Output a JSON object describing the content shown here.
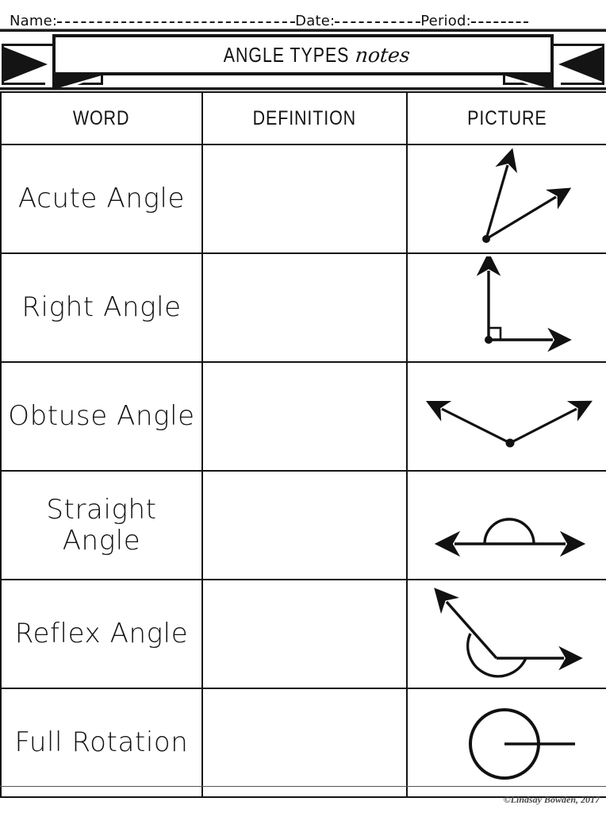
{
  "header": {
    "name_label": "Name:",
    "date_label": "Date:",
    "period_label": "Period:",
    "name_value": "",
    "date_value": "",
    "period_value": ""
  },
  "banner": {
    "title_caps": "ANGLE TYPES",
    "title_script": "notes"
  },
  "table": {
    "columns": [
      "WORD",
      "DEFINITION",
      "PICTURE"
    ],
    "rows": [
      {
        "word": "Acute Angle",
        "definition": "",
        "picture": "acute-angle-diagram"
      },
      {
        "word": "Right Angle",
        "definition": "",
        "picture": "right-angle-diagram"
      },
      {
        "word": "Obtuse Angle",
        "definition": "",
        "picture": "obtuse-angle-diagram"
      },
      {
        "word": "Straight Angle",
        "definition": "",
        "picture": "straight-angle-diagram"
      },
      {
        "word": "Reflex Angle",
        "definition": "",
        "picture": "reflex-angle-diagram"
      },
      {
        "word": "Full Rotation",
        "definition": "",
        "picture": "full-rotation-diagram"
      }
    ]
  },
  "footer": {
    "copyright": "©Lindsay Bowden, 2017"
  },
  "colors": {
    "ink": "#141414",
    "header_fill": "#ebebe1",
    "page": "#ffffff"
  }
}
